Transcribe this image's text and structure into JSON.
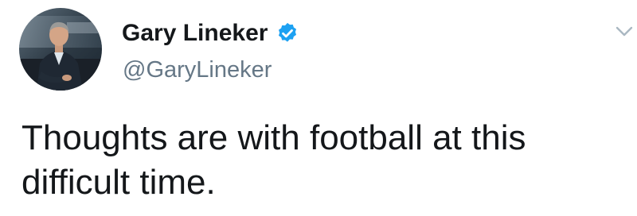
{
  "tweet": {
    "author": {
      "display_name": "Gary Lineker",
      "handle": "@GaryLineker",
      "verified": true
    },
    "text": "Thoughts are with football at this difficult time.",
    "icons": {
      "verified": "verified-badge-icon",
      "menu": "chevron-down-icon"
    },
    "colors": {
      "verified_badge": "#1da1f2",
      "handle": "#657786",
      "text": "#14171a",
      "caret": "#aab8c2"
    }
  }
}
